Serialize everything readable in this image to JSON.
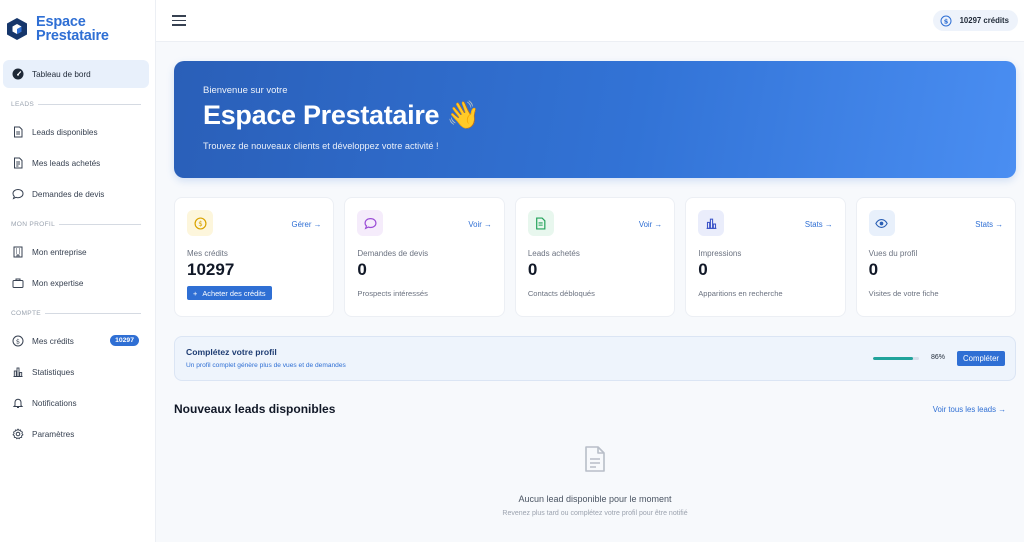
{
  "brand": {
    "line1": "Espace",
    "line2": "Prestataire"
  },
  "sidebar": {
    "dashboard": "Tableau de bord",
    "sections": {
      "leads": "LEADS",
      "profile": "MON PROFIL",
      "account": "COMPTE"
    },
    "leads_items": [
      {
        "label": "Leads disponibles",
        "icon": "file-icon"
      },
      {
        "label": "Mes leads achetés",
        "icon": "file-lines-icon"
      },
      {
        "label": "Demandes de devis",
        "icon": "chat-bubble-icon"
      }
    ],
    "profile_items": [
      {
        "label": "Mon entreprise",
        "icon": "building-icon"
      },
      {
        "label": "Mon expertise",
        "icon": "briefcase-icon"
      }
    ],
    "account_items": [
      {
        "label": "Mes crédits",
        "icon": "dollar-coin-icon",
        "badge": "10297"
      },
      {
        "label": "Statistiques",
        "icon": "bar-chart-icon"
      },
      {
        "label": "Notifications",
        "icon": "bell-icon"
      },
      {
        "label": "Paramètres",
        "icon": "gear-icon"
      }
    ]
  },
  "topbar": {
    "credits": "10297 crédits"
  },
  "hero": {
    "subtitle": "Bienvenue sur votre",
    "title": "Espace Prestataire 👋",
    "description": "Trouvez de nouveaux clients et développez votre activité !"
  },
  "cards": [
    {
      "action": "Gérer",
      "label": "Mes crédits",
      "value": "10297",
      "button": "Acheter des crédits",
      "icon": "dollar-coin-icon",
      "color": "#d9a300",
      "bg": "#fdf6dc"
    },
    {
      "action": "Voir",
      "label": "Demandes de devis",
      "value": "0",
      "sub": "Prospects intéressés",
      "icon": "chat-bubble-icon",
      "color": "#9b4dd6",
      "bg": "#f5ecfb"
    },
    {
      "action": "Voir",
      "label": "Leads achetés",
      "value": "0",
      "sub": "Contacts débloqués",
      "icon": "file-lines-icon",
      "color": "#22a35a",
      "bg": "#e8f7ee"
    },
    {
      "action": "Stats",
      "label": "Impressions",
      "value": "0",
      "sub": "Apparitions en recherche",
      "icon": "bar-chart-icon",
      "color": "#3d55c8",
      "bg": "#eaedfb"
    },
    {
      "action": "Stats",
      "label": "Vues du profil",
      "value": "0",
      "sub": "Visites de votre fiche",
      "icon": "eye-icon",
      "color": "#2b5fb4",
      "bg": "#e8f0fb"
    }
  ],
  "profile_completion": {
    "title": "Complétez votre profil",
    "description": "Un profil complet génère plus de vues et de demandes",
    "percent_label": "86%",
    "progress": 0.86,
    "button": "Compléter"
  },
  "leads": {
    "title": "Nouveaux leads disponibles",
    "link": "Voir tous les leads",
    "empty_title": "Aucun lead disponible pour le moment",
    "empty_desc": "Revenez plus tard ou complétez votre profil pour être notifié"
  },
  "colors": {
    "accent": "#2f6fd4",
    "progress": "#21a39b"
  }
}
